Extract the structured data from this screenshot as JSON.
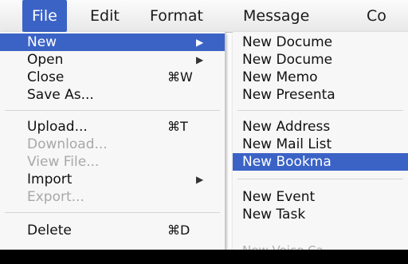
{
  "menubar": {
    "items": [
      "File",
      "Edit",
      "Format",
      "Message",
      "Co"
    ]
  },
  "file_menu": {
    "items": [
      {
        "label": "New",
        "shortcut": "",
        "submenu": true,
        "state": "highlighted"
      },
      {
        "label": "Open",
        "shortcut": "",
        "submenu": true,
        "state": "enabled"
      },
      {
        "label": "Close",
        "shortcut": "⌘W",
        "submenu": false,
        "state": "enabled"
      },
      {
        "label": "Save As...",
        "shortcut": "",
        "submenu": false,
        "state": "enabled"
      },
      {
        "label": "Upload...",
        "shortcut": "⌘T",
        "submenu": false,
        "state": "enabled"
      },
      {
        "label": "Download...",
        "shortcut": "",
        "submenu": false,
        "state": "disabled"
      },
      {
        "label": "View File...",
        "shortcut": "",
        "submenu": false,
        "state": "disabled"
      },
      {
        "label": "Import",
        "shortcut": "",
        "submenu": true,
        "state": "enabled"
      },
      {
        "label": "Export...",
        "shortcut": "",
        "submenu": false,
        "state": "disabled"
      },
      {
        "label": "Delete",
        "shortcut": "⌘D",
        "submenu": false,
        "state": "enabled"
      }
    ]
  },
  "new_submenu": {
    "items": [
      {
        "label": "New Docume",
        "state": "enabled"
      },
      {
        "label": "New Docume",
        "state": "enabled"
      },
      {
        "label": "New Memo",
        "state": "enabled"
      },
      {
        "label": "New Presenta",
        "state": "enabled"
      },
      {
        "label": "New Address",
        "state": "enabled"
      },
      {
        "label": "New Mail List",
        "state": "enabled"
      },
      {
        "label": "New Bookma",
        "state": "highlighted"
      },
      {
        "label": "New Event",
        "state": "enabled"
      },
      {
        "label": "New Task",
        "state": "enabled"
      }
    ],
    "partial_item": "New Voice Ca"
  },
  "colors": {
    "highlight": "#3b63c6",
    "disabled_text": "#a8a8a8",
    "menu_bg": "#f7f7f7"
  }
}
